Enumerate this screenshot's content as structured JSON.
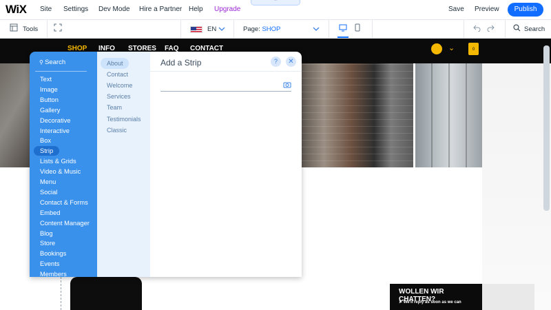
{
  "topbar": {
    "logo": "WiX",
    "menu": [
      "Site",
      "Settings",
      "Dev Mode",
      "Hire a Partner",
      "Help",
      "Upgrade"
    ],
    "collapse_icon": "chevron-up-icon",
    "save": "Save",
    "preview": "Preview",
    "publish": "Publish",
    "publish_color": "#116dff"
  },
  "toolbar": {
    "tools": "Tools",
    "language": "EN",
    "page_prefix": "Page:",
    "page_name": "SHOP",
    "search": "Search"
  },
  "site": {
    "nav": [
      "SHOP",
      "INFO",
      "STORES",
      "FAQ",
      "CONTACT"
    ],
    "active_color": "#f5b800",
    "cart_count": "0",
    "chat_title": "WOLLEN WIR CHATTEN?",
    "chat_subtitle": "We'll reply as soon as we can"
  },
  "add_panel": {
    "search": "Search",
    "categories": [
      "Text",
      "Image",
      "Button",
      "Gallery",
      "Decorative",
      "Interactive",
      "Box",
      "Strip",
      "Lists & Grids",
      "Video & Music",
      "Menu",
      "Social",
      "Contact & Forms",
      "Embed",
      "Content Manager",
      "Blog",
      "Store",
      "Bookings",
      "Events",
      "Members"
    ],
    "selected_category": "Strip",
    "subcategories": [
      "About",
      "Contact",
      "Welcome",
      "Services",
      "Team",
      "Testimonials",
      "Classic"
    ],
    "selected_subcategory": "About",
    "title": "Add a Strip",
    "help": "?",
    "close": "✕"
  }
}
